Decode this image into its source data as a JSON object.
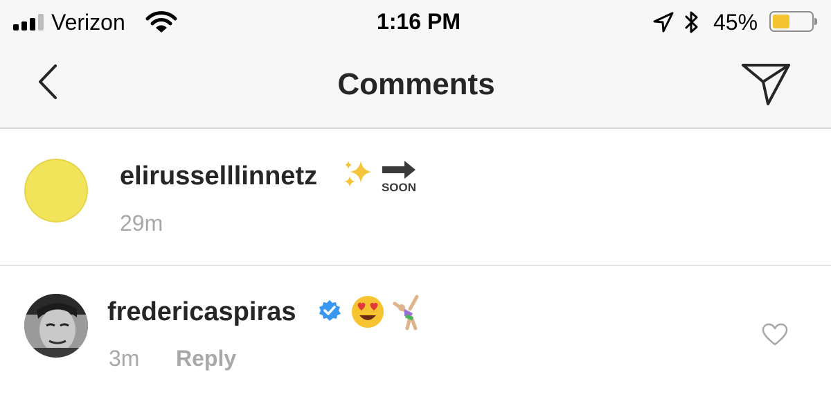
{
  "status_bar": {
    "carrier": "Verizon",
    "time": "1:16 PM",
    "battery_percent": "45%",
    "battery_level": 0.45,
    "battery_color": "#f4c430",
    "signal_bars": 3,
    "icons": [
      "signal-bars-icon",
      "wifi-icon",
      "location-arrow-icon",
      "bluetooth-icon",
      "battery-icon"
    ]
  },
  "nav": {
    "title": "Comments",
    "back_icon": "chevron-left-icon",
    "share_icon": "paper-plane-icon"
  },
  "comments": [
    {
      "username": "elirusselllinnetz",
      "emoji": [
        "sparkles",
        "soon-arrow"
      ],
      "time": "29m",
      "avatar_color": "#f1e35a"
    },
    {
      "username": "fredericaspiras",
      "verified": true,
      "emoji": [
        "heart-eyes",
        "cartwheel"
      ],
      "time": "3m",
      "reply_label": "Reply",
      "like_icon": "heart-outline-icon"
    }
  ],
  "colors": {
    "text_primary": "#262626",
    "text_secondary": "#a8a8a8",
    "verified_blue": "#3897f0",
    "bar_background": "#f7f7f7"
  }
}
